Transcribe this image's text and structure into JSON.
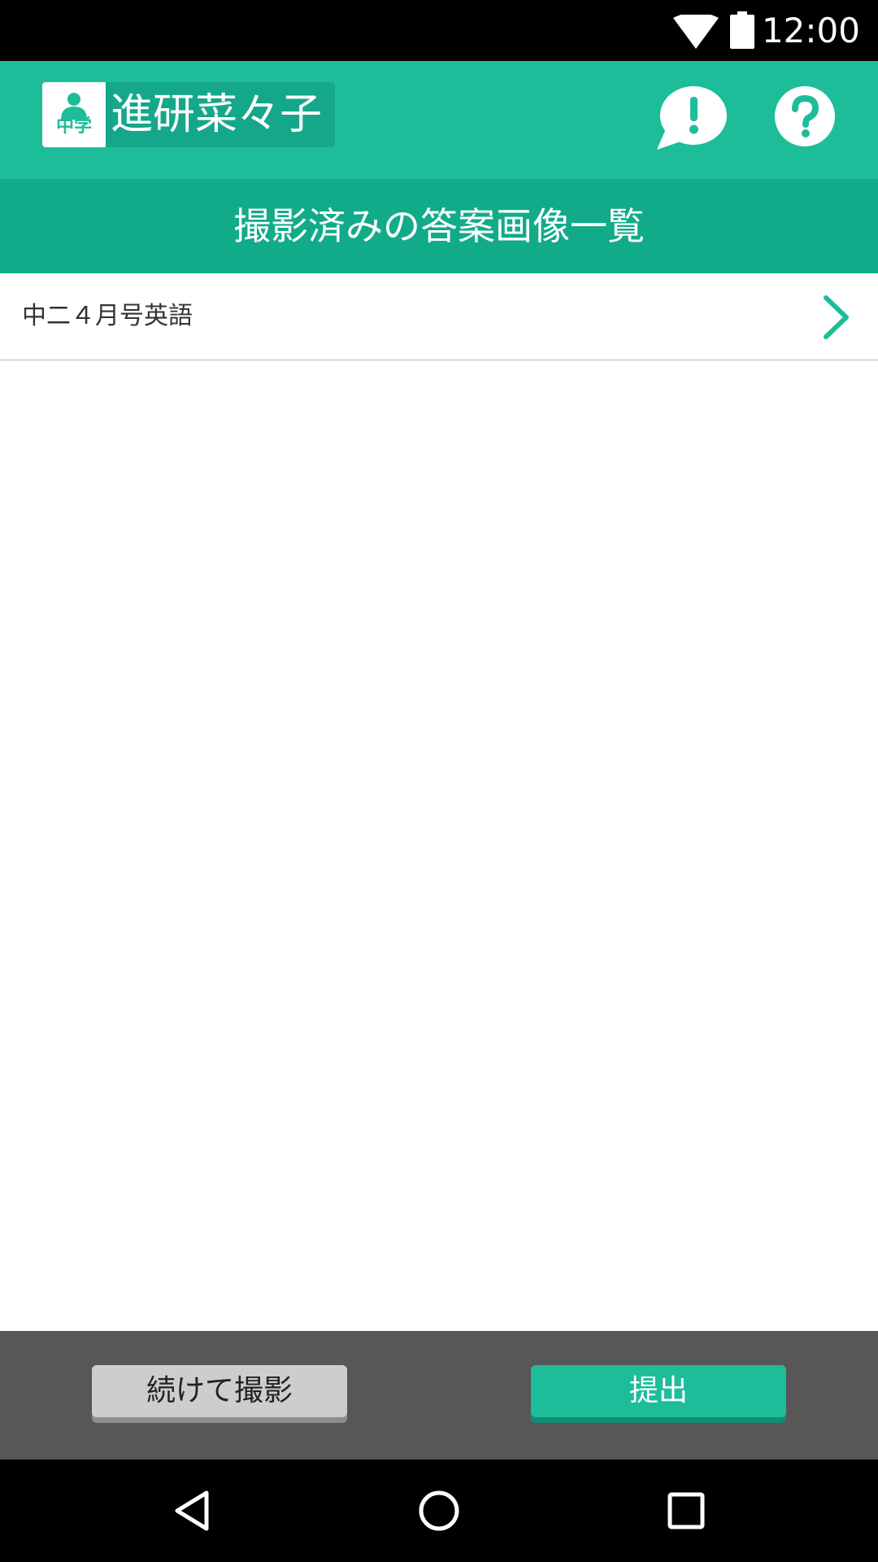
{
  "status_bar": {
    "time": "12:00",
    "icons": [
      "wifi-icon",
      "battery-icon"
    ]
  },
  "app_bar": {
    "badge_grade": "中学",
    "user_name": "進研菜々子",
    "notice_icon": "exclamation-speech-bubble-icon",
    "help_icon": "question-circle-icon",
    "accent_color": "#1ebd9a"
  },
  "page": {
    "title": "撮影済みの答案画像一覧"
  },
  "list": {
    "items": [
      {
        "label": "中二４月号英語",
        "icon": "chevron-right-icon"
      }
    ]
  },
  "actions": {
    "continue_label": "続けて撮影",
    "submit_label": "提出"
  },
  "nav_bar": {
    "icons": [
      "back-icon",
      "home-icon",
      "recent-apps-icon"
    ]
  }
}
